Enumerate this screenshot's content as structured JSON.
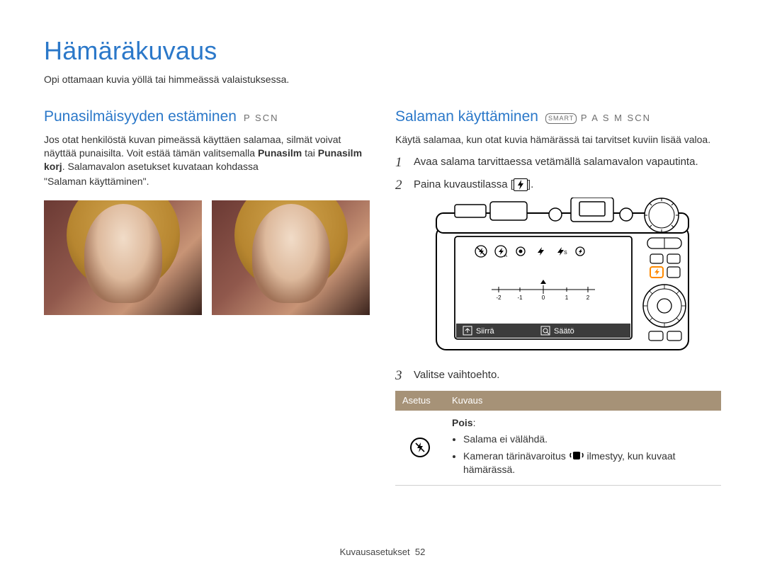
{
  "page_title": "Hämäräkuvaus",
  "subtitle": "Opi ottamaan kuvia yöllä tai himmeässä valaistuksessa.",
  "left": {
    "heading": "Punasilmäisyyden estäminen",
    "modes": "P SCN",
    "para_before_strong1": "Jos otat henkilöstä kuvan pimeässä käyttäen salamaa, silmät voivat näyttää punaisilta. Voit estää tämän valitsemalla ",
    "strong1": "Punasilm",
    "between_strongs": " tai ",
    "strong2": "Punasilm korj",
    "after_strong2": ". Salamavalon asetukset kuvataan kohdassa",
    "last_line": "\"Salaman käyttäminen\"."
  },
  "right": {
    "heading": "Salaman käyttäminen",
    "smart_label": "SMART",
    "modes_after_smart": "P A S M SCN",
    "para": "Käytä salamaa, kun otat kuvia hämärässä tai tarvitset kuviin lisää valoa.",
    "step1": "Avaa salama tarvittaessa vetämällä salamavalon vapautinta.",
    "step2_before": "Paina kuvaustilassa [",
    "step2_after": "].",
    "step3": "Valitse vaihtoehto.",
    "table": {
      "head_setting": "Asetus",
      "head_desc": "Kuvaus",
      "row1": {
        "label": "Pois",
        "bullet1": "Salama ei välähdä.",
        "bullet2_before": "Kameran tärinävaroitus ",
        "bullet2_after": " ilmestyy, kun kuvaat hämärässä."
      }
    }
  },
  "camera_screen": {
    "move_label": "Siirrä",
    "adjust_label": "Säätö"
  },
  "footer": {
    "section": "Kuvausasetukset",
    "page": "52"
  }
}
